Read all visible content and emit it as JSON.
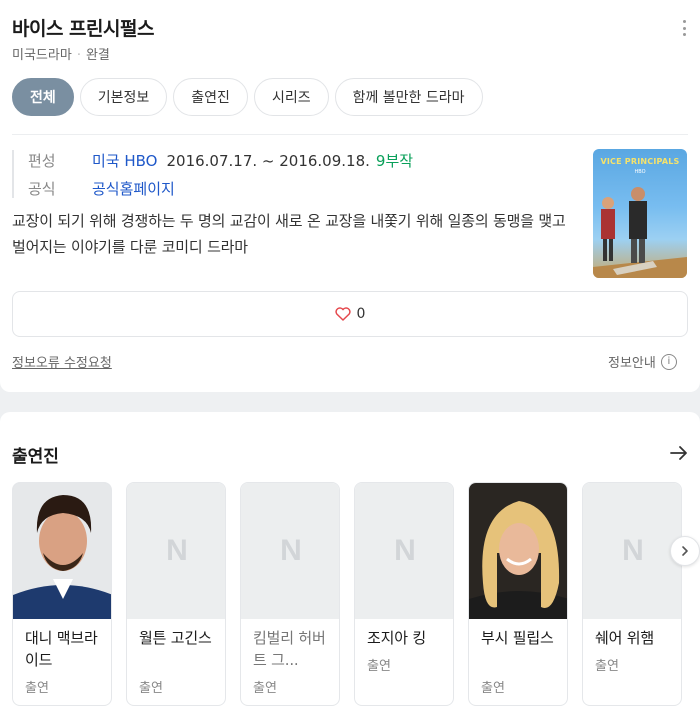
{
  "header": {
    "title": "바이스 프린시펄스",
    "category": "미국드라마",
    "status": "완결"
  },
  "tabs": [
    {
      "label": "전체",
      "active": true
    },
    {
      "label": "기본정보",
      "active": false
    },
    {
      "label": "출연진",
      "active": false
    },
    {
      "label": "시리즈",
      "active": false
    },
    {
      "label": "함께 볼만한 드라마",
      "active": false
    }
  ],
  "info": {
    "broadcast_label": "편성",
    "network": "미국 HBO",
    "dates": "2016.07.17. ~ 2016.09.18.",
    "episodes": "9부작",
    "official_label": "공식",
    "official_link": "공식홈페이지",
    "description": "교장이 되기 위해 경쟁하는 두 명의 교감이 새로 온 교장을 내쫓기 위해 일종의 동맹을 맺고 벌어지는 이야기를 다룬 코미디 드라마",
    "poster_title": "VICE PRINCIPALS",
    "poster_brand": "HBO"
  },
  "like": {
    "count": "0"
  },
  "footer": {
    "report": "정보오류 수정요청",
    "guide": "정보안내",
    "guide_icon": "i"
  },
  "cast": {
    "title": "출연진",
    "placeholder_logo": "N",
    "members": [
      {
        "name": "대니 맥브라이드",
        "role": "출연",
        "photo": true
      },
      {
        "name": "월튼 고긴스",
        "role": "출연",
        "photo": false
      },
      {
        "name": "킴벌리 허버트 그...",
        "role": "출연",
        "photo": false
      },
      {
        "name": "조지아 킹",
        "role": "출연",
        "photo": false
      },
      {
        "name": "부시 필립스",
        "role": "출연",
        "photo": true
      },
      {
        "name": "쉐어 위햄",
        "role": "출연",
        "photo": false
      }
    ]
  },
  "colors": {
    "accent_tab": "#7a8fa1",
    "link": "#1f58c9",
    "episodes": "#0aa05a",
    "heart": "#e5484d"
  }
}
